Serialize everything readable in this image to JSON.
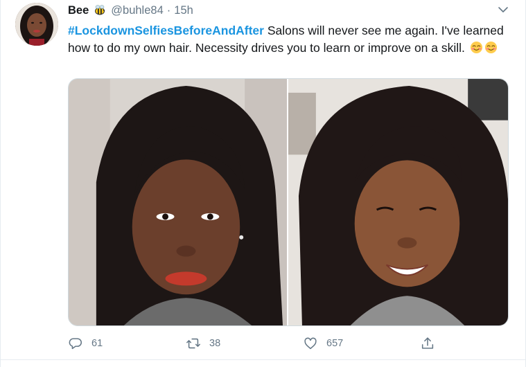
{
  "tweet": {
    "display_name": "Bee",
    "name_emoji_icon": "honeybee-emoji",
    "handle": "@buhle84",
    "separator": "·",
    "timestamp": "15h",
    "hashtag": "#LockdownSelfiesBeforeAndAfter",
    "body_text": " Salons will never see me again. I've learned how to do my own hair. Necessity drives you to learn or improve on a skill. ",
    "trailing_emoji": [
      "smiling-face-with-blush-emoji",
      "smiling-face-with-blush-emoji"
    ],
    "media": [
      {
        "alt_icon": "before-selfie-photo"
      },
      {
        "alt_icon": "after-selfie-photo"
      }
    ]
  },
  "actions": {
    "reply_count": "61",
    "retweet_count": "38",
    "like_count": "657"
  },
  "colors": {
    "link": "#1b95e0",
    "secondary_text": "#657786",
    "primary_text": "#14171a",
    "border": "#e6ecf0"
  }
}
